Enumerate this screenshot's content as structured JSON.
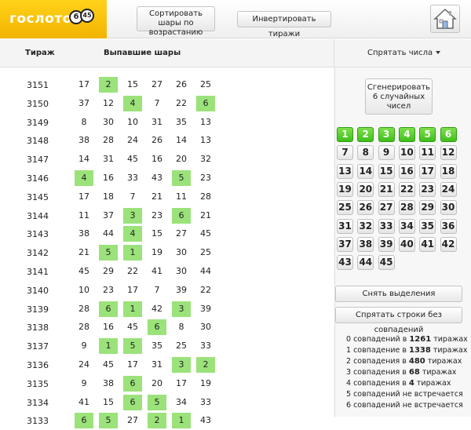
{
  "header": {
    "logo_text": "гослото",
    "logo_ball_1": "6",
    "logo_ball_2": "45",
    "sort_button": "Сортировать шары по возрастанию",
    "invert_button": "Инвертировать тиражи"
  },
  "table": {
    "col_draw": "Тираж",
    "col_balls": "Выпавшие шары",
    "hide_numbers": "Спрятать числа",
    "rows": [
      {
        "draw": "3151",
        "balls": [
          "17",
          "2",
          "15",
          "27",
          "26",
          "25"
        ],
        "hits": [
          false,
          true,
          false,
          false,
          false,
          false
        ]
      },
      {
        "draw": "3150",
        "balls": [
          "37",
          "12",
          "4",
          "7",
          "22",
          "6"
        ],
        "hits": [
          false,
          false,
          true,
          false,
          false,
          true
        ]
      },
      {
        "draw": "3149",
        "balls": [
          "8",
          "30",
          "10",
          "31",
          "35",
          "13"
        ],
        "hits": [
          false,
          false,
          false,
          false,
          false,
          false
        ]
      },
      {
        "draw": "3148",
        "balls": [
          "38",
          "28",
          "24",
          "26",
          "14",
          "13"
        ],
        "hits": [
          false,
          false,
          false,
          false,
          false,
          false
        ]
      },
      {
        "draw": "3147",
        "balls": [
          "14",
          "31",
          "45",
          "16",
          "20",
          "32"
        ],
        "hits": [
          false,
          false,
          false,
          false,
          false,
          false
        ]
      },
      {
        "draw": "3146",
        "balls": [
          "4",
          "16",
          "33",
          "43",
          "5",
          "23"
        ],
        "hits": [
          true,
          false,
          false,
          false,
          true,
          false
        ]
      },
      {
        "draw": "3145",
        "balls": [
          "17",
          "18",
          "7",
          "21",
          "11",
          "28"
        ],
        "hits": [
          false,
          false,
          false,
          false,
          false,
          false
        ]
      },
      {
        "draw": "3144",
        "balls": [
          "11",
          "37",
          "3",
          "23",
          "6",
          "21"
        ],
        "hits": [
          false,
          false,
          true,
          false,
          true,
          false
        ]
      },
      {
        "draw": "3143",
        "balls": [
          "38",
          "44",
          "4",
          "15",
          "27",
          "45"
        ],
        "hits": [
          false,
          false,
          true,
          false,
          false,
          false
        ]
      },
      {
        "draw": "3142",
        "balls": [
          "21",
          "5",
          "1",
          "19",
          "30",
          "25"
        ],
        "hits": [
          false,
          true,
          true,
          false,
          false,
          false
        ]
      },
      {
        "draw": "3141",
        "balls": [
          "45",
          "29",
          "22",
          "41",
          "30",
          "44"
        ],
        "hits": [
          false,
          false,
          false,
          false,
          false,
          false
        ]
      },
      {
        "draw": "3140",
        "balls": [
          "10",
          "23",
          "17",
          "7",
          "39",
          "22"
        ],
        "hits": [
          false,
          false,
          false,
          false,
          false,
          false
        ]
      },
      {
        "draw": "3139",
        "balls": [
          "28",
          "6",
          "1",
          "42",
          "3",
          "39"
        ],
        "hits": [
          false,
          true,
          true,
          false,
          true,
          false
        ]
      },
      {
        "draw": "3138",
        "balls": [
          "28",
          "16",
          "45",
          "6",
          "8",
          "30"
        ],
        "hits": [
          false,
          false,
          false,
          true,
          false,
          false
        ]
      },
      {
        "draw": "3137",
        "balls": [
          "9",
          "1",
          "5",
          "35",
          "25",
          "33"
        ],
        "hits": [
          false,
          true,
          true,
          false,
          false,
          false
        ]
      },
      {
        "draw": "3136",
        "balls": [
          "24",
          "45",
          "17",
          "31",
          "3",
          "2"
        ],
        "hits": [
          false,
          false,
          false,
          false,
          true,
          true
        ]
      },
      {
        "draw": "3135",
        "balls": [
          "9",
          "38",
          "6",
          "20",
          "17",
          "19"
        ],
        "hits": [
          false,
          false,
          true,
          false,
          false,
          false
        ]
      },
      {
        "draw": "3134",
        "balls": [
          "41",
          "15",
          "6",
          "5",
          "34",
          "33"
        ],
        "hits": [
          false,
          false,
          true,
          true,
          false,
          false
        ]
      },
      {
        "draw": "3133",
        "balls": [
          "6",
          "5",
          "27",
          "2",
          "1",
          "43"
        ],
        "hits": [
          true,
          true,
          false,
          true,
          true,
          false
        ]
      }
    ]
  },
  "sidebar": {
    "generate_button": "Сгенерировать 6 случайных чисел",
    "numbers": [
      "1",
      "2",
      "3",
      "4",
      "5",
      "6",
      "7",
      "8",
      "9",
      "10",
      "11",
      "12",
      "13",
      "14",
      "15",
      "16",
      "17",
      "18",
      "19",
      "20",
      "21",
      "22",
      "23",
      "24",
      "25",
      "26",
      "27",
      "28",
      "29",
      "30",
      "31",
      "32",
      "33",
      "34",
      "35",
      "36",
      "37",
      "38",
      "39",
      "40",
      "41",
      "42",
      "43",
      "44",
      "45"
    ],
    "selected_count": 6,
    "clear_button": "Снять выделения",
    "hide_rows_button": "Спрятать строки без совпадений",
    "stats": [
      {
        "pre": "0 совпадений в ",
        "count": "1261",
        "post": " тиражах"
      },
      {
        "pre": "1 совпадение в ",
        "count": "1338",
        "post": " тиражах"
      },
      {
        "pre": "2 совпадения в ",
        "count": "480",
        "post": " тиражах"
      },
      {
        "pre": "3 совпадения в ",
        "count": "68",
        "post": " тиражах"
      },
      {
        "pre": "4 совпадения в ",
        "count": "4",
        "post": " тиражах"
      },
      {
        "pre": "5 совпадений не встречается",
        "count": "",
        "post": ""
      },
      {
        "pre": "6 совпадений не встречается",
        "count": "",
        "post": ""
      }
    ]
  },
  "colors": {
    "logo_yellow": "#f5bb00",
    "hit_green": "#9be27a",
    "selected_green": "#47c21e"
  },
  "icons": {
    "home": "home-icon"
  }
}
